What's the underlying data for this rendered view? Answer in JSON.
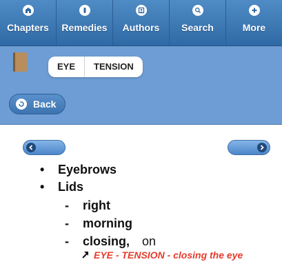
{
  "tabs": [
    {
      "label": "Chapters",
      "icon": "chapters-icon"
    },
    {
      "label": "Remedies",
      "icon": "remedies-icon"
    },
    {
      "label": "Authors",
      "icon": "authors-icon"
    },
    {
      "label": "Search",
      "icon": "search-icon"
    },
    {
      "label": "More",
      "icon": "plus-icon"
    }
  ],
  "breadcrumb": [
    "EYE",
    "TENSION"
  ],
  "back_label": "Back",
  "rubrics": {
    "eyebrows": "Eyebrows",
    "lids": "Lids",
    "right": "right",
    "morning": "morning",
    "closing": "closing,",
    "on": "on"
  },
  "cross_reference": "EYE - TENSION - closing the eye",
  "colors": {
    "tabbar": "#2f6aa6",
    "header": "#6d9dd4",
    "link": "#e53b2c"
  }
}
